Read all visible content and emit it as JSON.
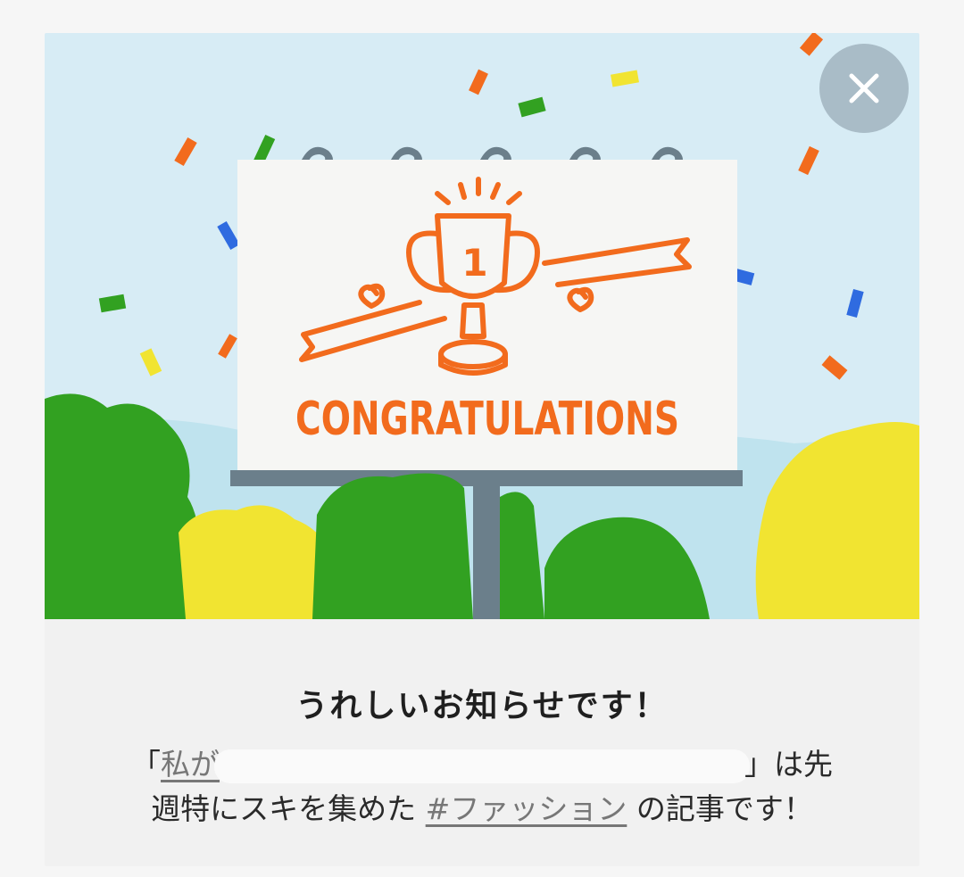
{
  "banner": {
    "sign_text": "CONGRATULATIONS",
    "trophy_number": "1"
  },
  "close_button": {
    "label": "×"
  },
  "message": {
    "headline": "うれしいお知らせです！",
    "open_quote": "「",
    "article_title_visible": "私が",
    "close_quote_and_text": "」は先",
    "line2_prefix": "週特にスキを集めた ",
    "hashtag": "#ファッション",
    "line2_suffix": " の記事です！"
  },
  "colors": {
    "sky": "#d7ecf5",
    "accent_orange": "#f26b1d",
    "tree_green": "#32a121",
    "tree_yellow": "#f1e431",
    "sign_pole": "#6b7f8b"
  }
}
